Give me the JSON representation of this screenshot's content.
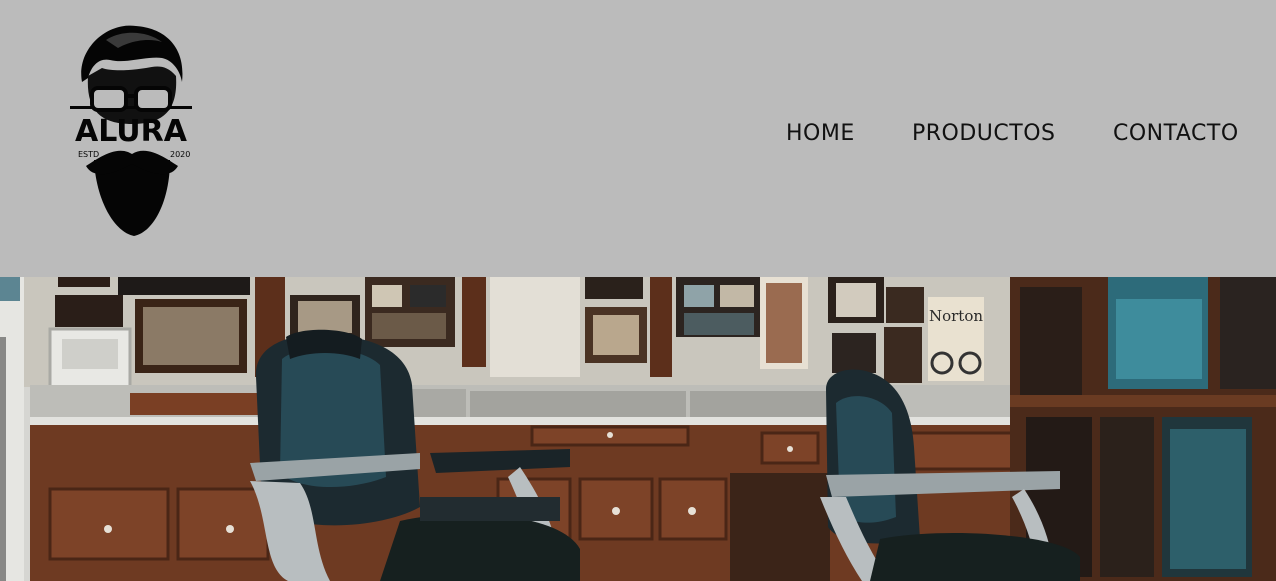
{
  "logo": {
    "brand": "ALURA",
    "left_text": "ESTD",
    "right_text": "2020",
    "icon": "bearded-man-icon"
  },
  "nav": {
    "items": [
      {
        "label": "HOME"
      },
      {
        "label": "PRODUCTOS"
      },
      {
        "label": "CONTACTO"
      }
    ]
  },
  "hero": {
    "icon": "barbershop-photo",
    "poster_text": "Norton"
  },
  "colors": {
    "header_bg": "#bbbbbb",
    "nav_text": "#111111",
    "wood": "#6e3a22",
    "chair_leather": "#1c2a30"
  }
}
